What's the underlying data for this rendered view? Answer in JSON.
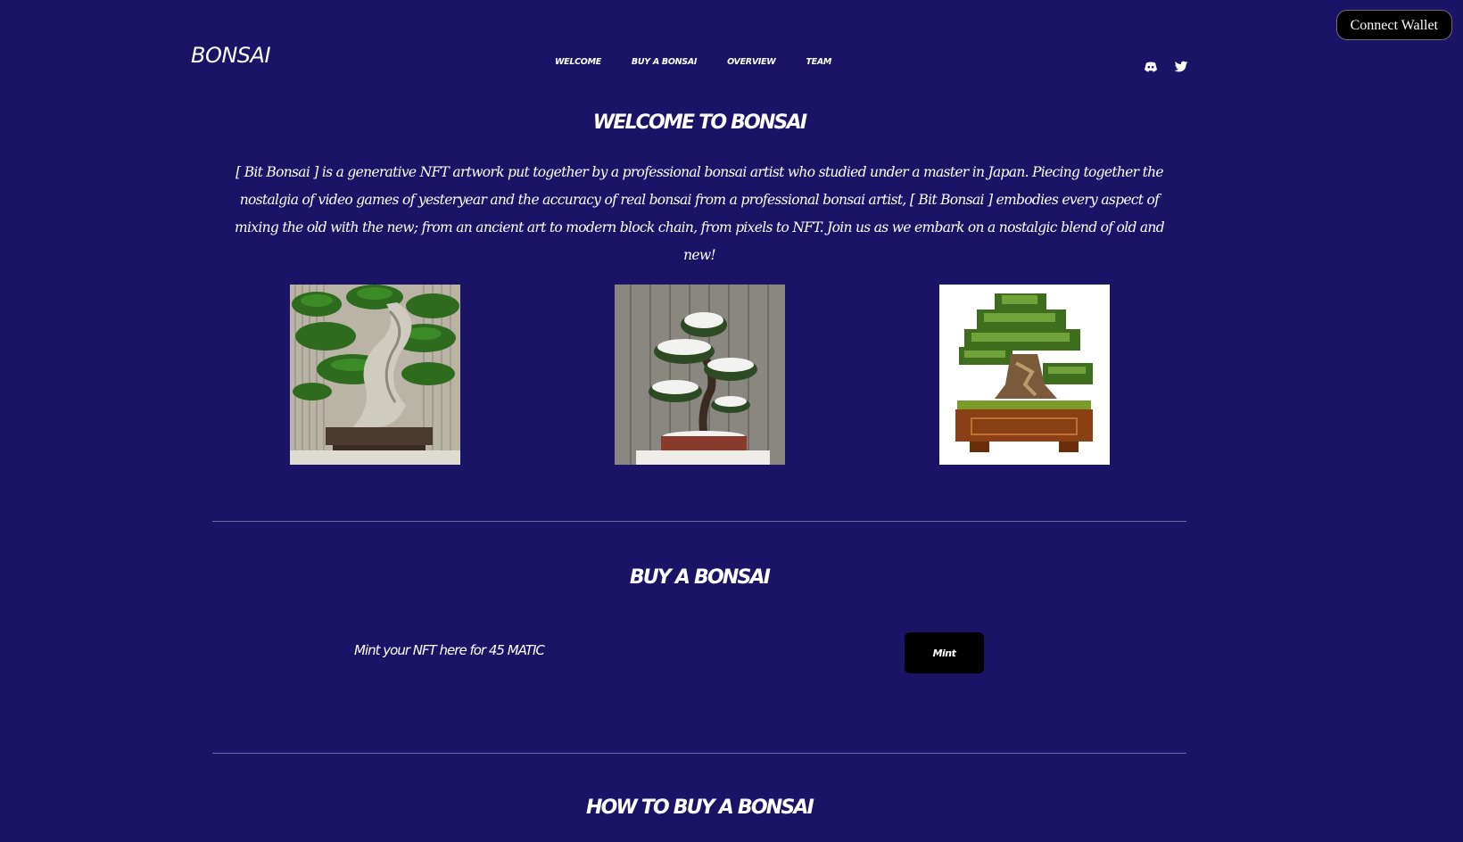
{
  "wallet": {
    "connect_label": "Connect Wallet"
  },
  "header": {
    "logo": "BONSAI",
    "nav": [
      "WELCOME",
      "BUY A BONSAI",
      "OVERVIEW",
      "TEAM"
    ],
    "social_icons": [
      "discord-icon",
      "twitter-icon"
    ]
  },
  "welcome": {
    "title": "WELCOME TO BONSAI",
    "description": "[ Bit Bonsai ] is a generative NFT artwork put together by a professional bonsai artist who studied under a master in Japan. Piecing together the nostalgia of video games of yesteryear and the accuracy of real bonsai from a professional bonsai artist, [ Bit Bonsai ] embodies every aspect of mixing the old with the new; from an ancient art to modern block chain, from pixels to NFT. Join us as we embark on a nostalgic blend of old and new!"
  },
  "buy": {
    "title": "BUY A BONSAI",
    "mint_text": "Mint your NFT here for 45 MATIC",
    "mint_label": "Mint"
  },
  "how_to": {
    "title": "HOW TO BUY A BONSAI"
  },
  "colors": {
    "background": "#1b1466",
    "button": "#000000",
    "text": "#ffffff",
    "divider": "#6d6a9a"
  }
}
